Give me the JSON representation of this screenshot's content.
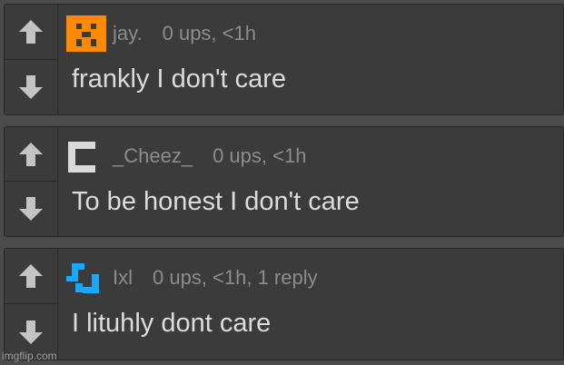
{
  "colors": {
    "background": "#4b4b4b",
    "comment_bg": "#3b3b3b",
    "meta_text": "#8c8c8c",
    "body_text": "#dcdcdc",
    "arrow": "#c4c4c4"
  },
  "icons": {
    "upvote": "arrow-up-icon",
    "downvote": "arrow-down-icon"
  },
  "comments": [
    {
      "avatar": "orange-pixel-face-avatar",
      "avatar_color": "#ff8a00",
      "username": "jay.",
      "stats": "0 ups, <1h",
      "text": "frankly I don't care"
    },
    {
      "avatar": "gray-c-block-avatar",
      "avatar_color": "#d9d9d9",
      "username": "_Cheez_",
      "stats": "0 ups, <1h",
      "text": "To be honest I don't care"
    },
    {
      "avatar": "blue-bracket-avatar",
      "avatar_color": "#19a7ff",
      "username": "Ixl",
      "stats": "0 ups, <1h, 1 reply",
      "text": "I lituhly dont care"
    }
  ],
  "watermark": "imgflip.com"
}
